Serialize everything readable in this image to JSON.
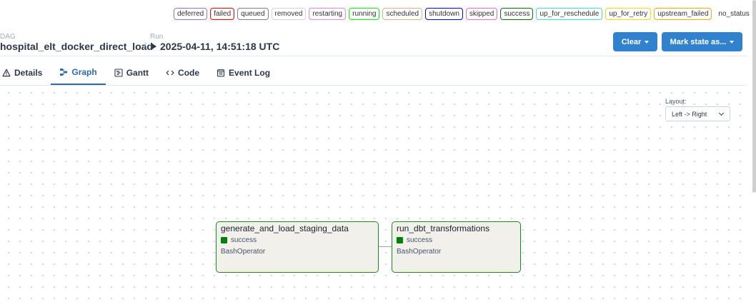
{
  "legend": [
    {
      "label": "deferred",
      "color": "#9370db"
    },
    {
      "label": "failed",
      "color": "#ff0000"
    },
    {
      "label": "queued",
      "color": "#808080"
    },
    {
      "label": "removed",
      "color": "#d3d3d3"
    },
    {
      "label": "restarting",
      "color": "#ee82ee"
    },
    {
      "label": "running",
      "color": "#00ff00"
    },
    {
      "label": "scheduled",
      "color": "#d2b48c"
    },
    {
      "label": "shutdown",
      "color": "#0000ff"
    },
    {
      "label": "skipped",
      "color": "#ff69b4"
    },
    {
      "label": "success",
      "color": "#008000"
    },
    {
      "label": "up_for_reschedule",
      "color": "#40e0d0"
    },
    {
      "label": "up_for_retry",
      "color": "#ffd700"
    },
    {
      "label": "upstream_failed",
      "color": "#ffa500"
    },
    {
      "label": "no_status",
      "color": ""
    }
  ],
  "header": {
    "dag_label": "DAG",
    "dag_id": "hospital_elt_docker_direct_load",
    "separator": "/",
    "run_label": "Run",
    "run_id": "2025-04-11, 14:51:18 UTC",
    "clear_label": "Clear",
    "mark_state_label": "Mark state as..."
  },
  "tabs": [
    {
      "label": "Details",
      "icon": "warning-icon"
    },
    {
      "label": "Graph",
      "icon": "graph-icon",
      "active": true
    },
    {
      "label": "Gantt",
      "icon": "gantt-icon"
    },
    {
      "label": "Code",
      "icon": "code-icon"
    },
    {
      "label": "Event Log",
      "icon": "event-log-icon"
    }
  ],
  "graph": {
    "layout_label": "Layout:",
    "layout_value": "Left -> Right",
    "nodes": [
      {
        "task_id": "generate_and_load_staging_data",
        "state": "success",
        "operator": "BashOperator"
      },
      {
        "task_id": "run_dbt_transformations",
        "state": "success",
        "operator": "BashOperator"
      }
    ],
    "state_color": "#008000"
  }
}
